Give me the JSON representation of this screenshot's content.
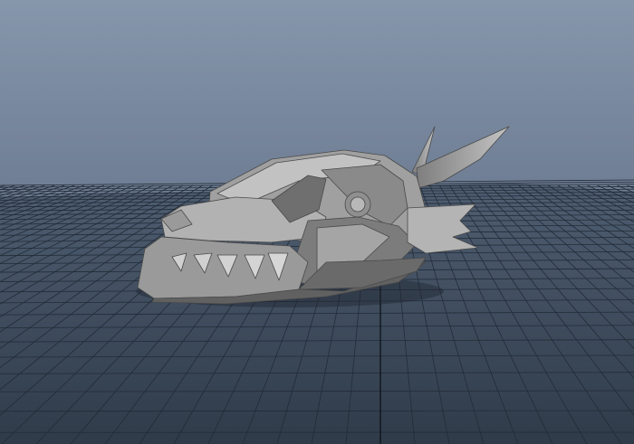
{
  "viewport": {
    "background_top": "#8796ab",
    "background_bottom": "#3e4b5b",
    "grid_line": "#1d2631",
    "grid_axis": "#0d1218"
  },
  "model": {
    "name": "dragon-skull-model",
    "shading": "default-gray",
    "base_color": "#8e8e8e"
  }
}
